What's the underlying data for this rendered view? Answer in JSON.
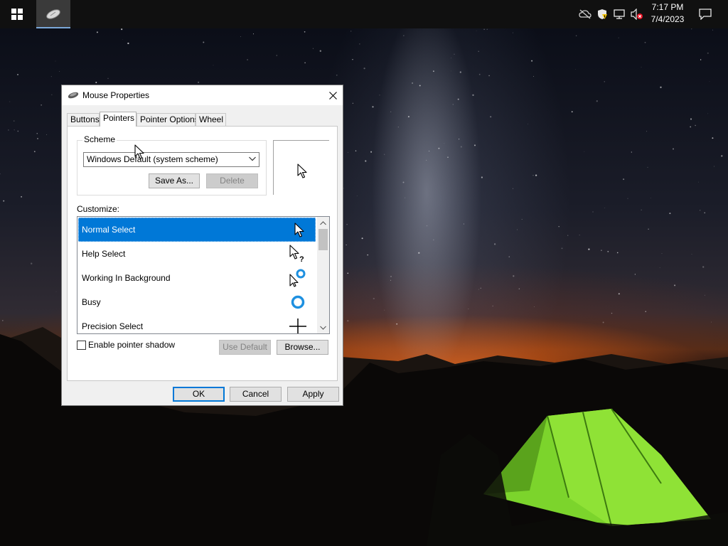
{
  "taskbar": {
    "start_icon": "windows-logo",
    "pinned_app_icon": "mouse-icon",
    "tray_icons": [
      "cloud-off-icon",
      "security-warning-icon",
      "network-icon",
      "volume-muted-icon"
    ],
    "time": "7:17 PM",
    "date": "7/4/2023",
    "notification_icon": "action-center-icon"
  },
  "dialog": {
    "title": "Mouse Properties",
    "tabs": [
      {
        "label": "Buttons",
        "active": false
      },
      {
        "label": "Pointers",
        "active": true
      },
      {
        "label": "Pointer Options",
        "active": false
      },
      {
        "label": "Wheel",
        "active": false
      }
    ],
    "scheme": {
      "group_label": "Scheme",
      "selected": "Windows Default (system scheme)",
      "save_as_label": "Save As...",
      "delete_label": "Delete"
    },
    "customize": {
      "label": "Customize:",
      "items": [
        {
          "label": "Normal Select",
          "cursor_icon": "arrow-cursor-icon",
          "selected": true
        },
        {
          "label": "Help Select",
          "cursor_icon": "help-cursor-icon",
          "selected": false
        },
        {
          "label": "Working In Background",
          "cursor_icon": "working-cursor-icon",
          "selected": false
        },
        {
          "label": "Busy",
          "cursor_icon": "busy-cursor-icon",
          "selected": false
        },
        {
          "label": "Precision Select",
          "cursor_icon": "crosshair-cursor-icon",
          "selected": false
        }
      ]
    },
    "pointer_shadow": {
      "label": "Enable pointer shadow",
      "checked": false
    },
    "use_default_label": "Use Default",
    "browse_label": "Browse...",
    "ok_label": "OK",
    "cancel_label": "Cancel",
    "apply_label": "Apply"
  },
  "colors": {
    "selection": "#0078d7",
    "taskbar": "#101010",
    "dialog_bg": "#f0f0f0"
  }
}
